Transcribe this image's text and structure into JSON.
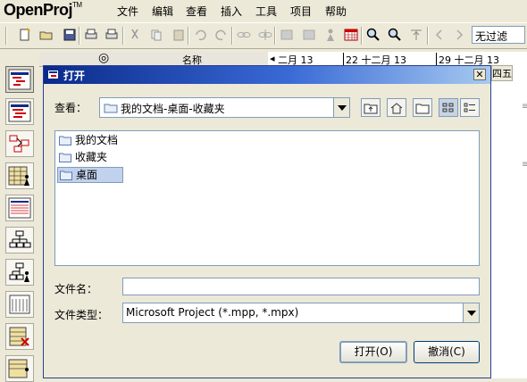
{
  "app": {
    "logo": "OpenProj",
    "logo_tm": "TM"
  },
  "menu": [
    "文件",
    "编辑",
    "查看",
    "插入",
    "工具",
    "项目",
    "帮助"
  ],
  "toolbar": {
    "filter_value": "无过滤"
  },
  "background": {
    "table_header_name": "名称",
    "gantt_weeks": [
      "二月 13",
      "22 十二月 13",
      "29 十二月 13"
    ],
    "gantt_day_tail": "四五"
  },
  "dialog": {
    "title": "打开",
    "close_glyph": "✕",
    "look_in_label": "查看：",
    "look_in_value": "我的文档-桌面-收藏夹",
    "files": [
      {
        "name": "我的文档",
        "selected": false
      },
      {
        "name": "收藏夹",
        "selected": false
      },
      {
        "name": "桌面",
        "selected": true
      }
    ],
    "filename_label": "文件名：",
    "filename_value": "",
    "filetype_label": "文件类型：",
    "filetype_value": "Microsoft Project (*.mpp, *.mpx)",
    "open_button": "打开(O)",
    "cancel_button": "撤消(C)"
  },
  "colors": {
    "window_bg": "#ece9d8",
    "titlebar_start": "#0a2a8a",
    "titlebar_end": "#a6caf0",
    "selection": "#c1d2ee",
    "border_blue": "#7f9db9"
  }
}
